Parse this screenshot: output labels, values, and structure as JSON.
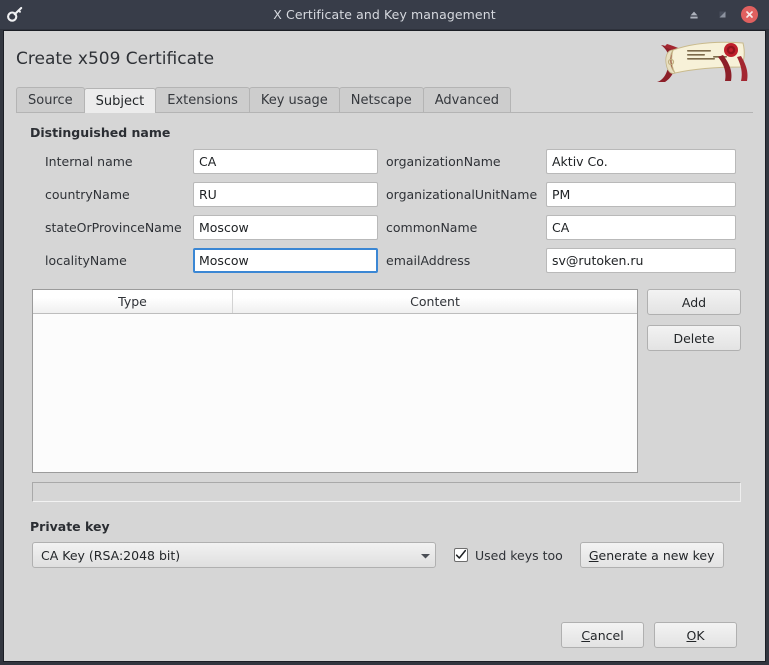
{
  "window": {
    "title": "X Certificate and Key management",
    "app_icon": "key-icon",
    "controls": {
      "minimize": "minimize-icon",
      "maximize": "maximize-icon",
      "close": "close-icon"
    }
  },
  "page": {
    "title": "Create x509 Certificate",
    "logo": "certificate-scroll-logo"
  },
  "tabs": [
    {
      "label": "Source",
      "active": false
    },
    {
      "label": "Subject",
      "active": true
    },
    {
      "label": "Extensions",
      "active": false
    },
    {
      "label": "Key usage",
      "active": false
    },
    {
      "label": "Netscape",
      "active": false
    },
    {
      "label": "Advanced",
      "active": false
    }
  ],
  "distinguished_name": {
    "group_label": "Distinguished name",
    "fields": [
      {
        "label": "Internal name",
        "value": "CA",
        "focused": false
      },
      {
        "label": "organizationName",
        "value": "Aktiv Co.",
        "focused": false
      },
      {
        "label": "countryName",
        "value": "RU",
        "focused": false
      },
      {
        "label": "organizationalUnitName",
        "value": "PM",
        "focused": false
      },
      {
        "label": "stateOrProvinceName",
        "value": "Moscow",
        "focused": false
      },
      {
        "label": "commonName",
        "value": "CA",
        "focused": false
      },
      {
        "label": "localityName",
        "value": "Moscow",
        "focused": true
      },
      {
        "label": "emailAddress",
        "value": "sv@rutoken.ru",
        "focused": false
      }
    ]
  },
  "extra_table": {
    "columns": [
      "Type",
      "Content"
    ],
    "rows": [],
    "add_label": "Add",
    "delete_label": "Delete"
  },
  "status_bar": {
    "text": ""
  },
  "private_key": {
    "group_label": "Private key",
    "selected": "CA Key (RSA:2048 bit)",
    "options": [
      "CA Key (RSA:2048 bit)"
    ],
    "used_keys_too": {
      "label": "Used keys too",
      "checked": true
    },
    "generate_button": {
      "mnemonic": "G",
      "rest": "enerate a new key"
    }
  },
  "footer": {
    "cancel": {
      "mnemonic": "C",
      "rest": "ancel"
    },
    "ok": {
      "mnemonic": "O",
      "rest": "K"
    }
  },
  "colors": {
    "titlebar": "#383d49",
    "window_bg": "#d6d6d6",
    "accent": "#4e93d4",
    "close": "#e0605f",
    "focus_border": "#3b87d4"
  }
}
